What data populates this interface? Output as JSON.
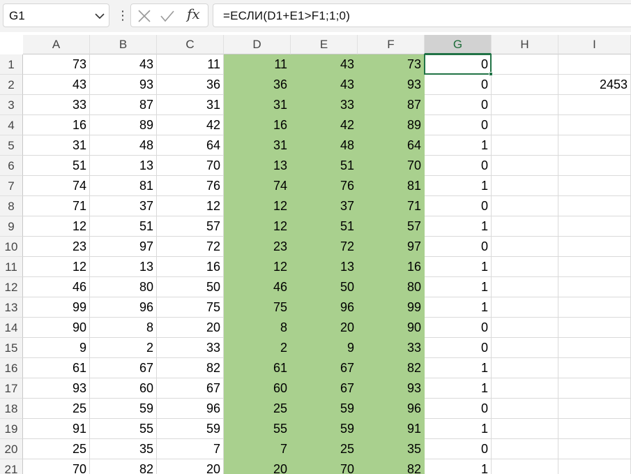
{
  "name_box": {
    "value": "G1"
  },
  "formula_bar": {
    "formula": "=ЕСЛИ(D1+E1>F1;1;0)",
    "cancel_icon": "close-icon",
    "enter_icon": "check-icon",
    "fx_label": "fx"
  },
  "sheet": {
    "columns": [
      "A",
      "B",
      "C",
      "D",
      "E",
      "F",
      "G",
      "H",
      "I"
    ],
    "selected_column": "G",
    "selected_cell": "G1",
    "highlight_color": "#a9d08e",
    "accent_color": "#217346",
    "row_numbers": [
      "1",
      "2",
      "3",
      "4",
      "5",
      "6",
      "7",
      "8",
      "9",
      "10",
      "11",
      "12",
      "13",
      "14",
      "15",
      "16",
      "17",
      "18",
      "19",
      "20",
      "21"
    ],
    "rows": [
      [
        "73",
        "43",
        "11",
        "11",
        "43",
        "73",
        "0",
        "",
        ""
      ],
      [
        "43",
        "93",
        "36",
        "36",
        "43",
        "93",
        "0",
        "",
        "2453"
      ],
      [
        "33",
        "87",
        "31",
        "31",
        "33",
        "87",
        "0",
        "",
        ""
      ],
      [
        "16",
        "89",
        "42",
        "16",
        "42",
        "89",
        "0",
        "",
        ""
      ],
      [
        "31",
        "48",
        "64",
        "31",
        "48",
        "64",
        "1",
        "",
        ""
      ],
      [
        "51",
        "13",
        "70",
        "13",
        "51",
        "70",
        "0",
        "",
        ""
      ],
      [
        "74",
        "81",
        "76",
        "74",
        "76",
        "81",
        "1",
        "",
        ""
      ],
      [
        "71",
        "37",
        "12",
        "12",
        "37",
        "71",
        "0",
        "",
        ""
      ],
      [
        "12",
        "51",
        "57",
        "12",
        "51",
        "57",
        "1",
        "",
        ""
      ],
      [
        "23",
        "97",
        "72",
        "23",
        "72",
        "97",
        "0",
        "",
        ""
      ],
      [
        "12",
        "13",
        "16",
        "12",
        "13",
        "16",
        "1",
        "",
        ""
      ],
      [
        "46",
        "80",
        "50",
        "46",
        "50",
        "80",
        "1",
        "",
        ""
      ],
      [
        "99",
        "96",
        "75",
        "75",
        "96",
        "99",
        "1",
        "",
        ""
      ],
      [
        "90",
        "8",
        "20",
        "8",
        "20",
        "90",
        "0",
        "",
        ""
      ],
      [
        "9",
        "2",
        "33",
        "2",
        "9",
        "33",
        "0",
        "",
        ""
      ],
      [
        "61",
        "67",
        "82",
        "61",
        "67",
        "82",
        "1",
        "",
        ""
      ],
      [
        "93",
        "60",
        "67",
        "60",
        "67",
        "93",
        "1",
        "",
        ""
      ],
      [
        "25",
        "59",
        "96",
        "25",
        "59",
        "96",
        "0",
        "",
        ""
      ],
      [
        "91",
        "55",
        "59",
        "55",
        "59",
        "91",
        "1",
        "",
        ""
      ],
      [
        "25",
        "35",
        "7",
        "7",
        "25",
        "35",
        "0",
        "",
        ""
      ],
      [
        "70",
        "82",
        "20",
        "20",
        "70",
        "82",
        "1",
        "",
        ""
      ]
    ]
  }
}
